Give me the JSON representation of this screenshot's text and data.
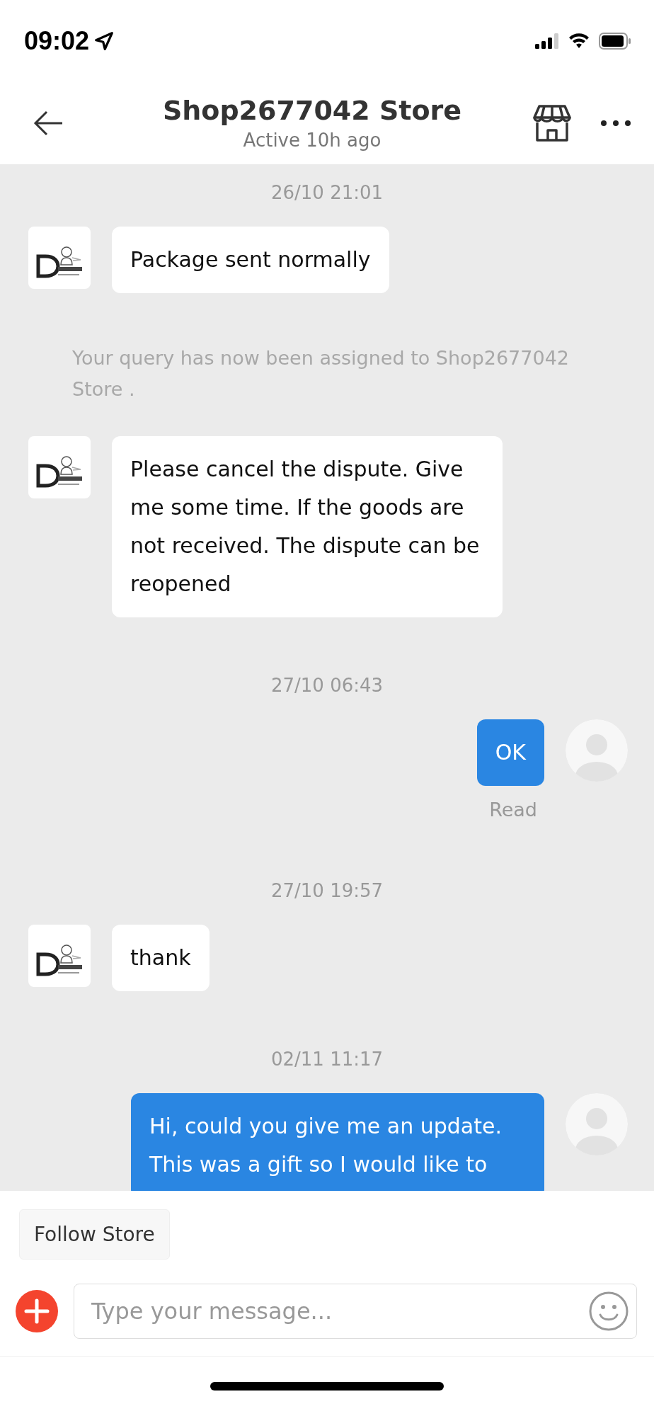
{
  "status_bar": {
    "time": "09:02"
  },
  "header": {
    "title": "Shop2677042 Store",
    "subtitle": "Active 10h ago"
  },
  "messages": [
    {
      "kind": "timestamp",
      "text": "26/10 21:01"
    },
    {
      "kind": "incoming",
      "text": "Package sent normally"
    },
    {
      "kind": "system",
      "text": "Your query has now been assigned to Shop2677042 Store ."
    },
    {
      "kind": "incoming",
      "text": "Please cancel the dispute. Give me some time. If the goods are not received. The dispute can be reopened"
    },
    {
      "kind": "timestamp",
      "text": "27/10 06:43"
    },
    {
      "kind": "outgoing",
      "text": "OK",
      "receipt": "Read"
    },
    {
      "kind": "timestamp",
      "text": "27/10 19:57"
    },
    {
      "kind": "incoming",
      "text": "thank"
    },
    {
      "kind": "timestamp",
      "text": "02/11 11:17"
    },
    {
      "kind": "outgoing",
      "text": "Hi, could you give me an update. This was a gift so I would like to"
    }
  ],
  "follow_button": "Follow Store",
  "composer": {
    "placeholder": "Type your message..."
  }
}
